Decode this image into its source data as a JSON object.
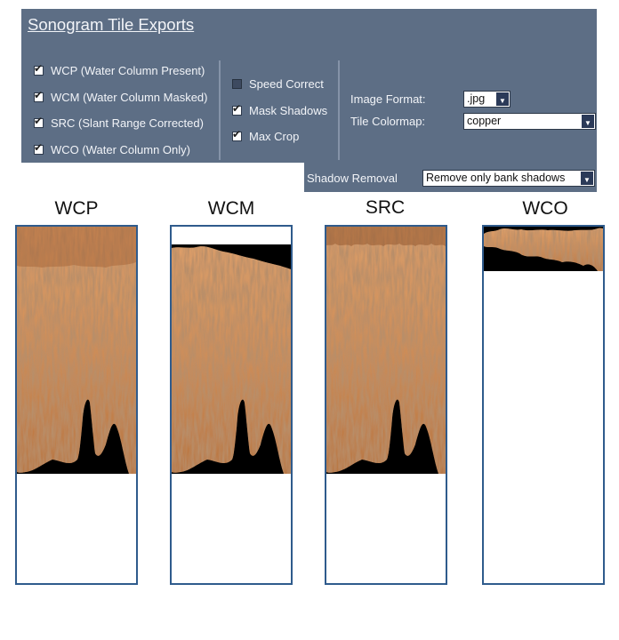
{
  "panel": {
    "title": "Sonogram Tile Exports",
    "exports": [
      {
        "label": "WCP (Water Column Present)",
        "checked": true
      },
      {
        "label": "WCM (Water Column Masked)",
        "checked": true
      },
      {
        "label": "SRC (Slant Range Corrected)",
        "checked": true
      },
      {
        "label": "WCO (Water Column Only)",
        "checked": true
      }
    ],
    "options": [
      {
        "label": "Speed Correct",
        "checked": false
      },
      {
        "label": "Mask Shadows",
        "checked": true
      },
      {
        "label": "Max Crop",
        "checked": true
      }
    ],
    "image_format": {
      "label": "Image Format:",
      "value": ".jpg"
    },
    "tile_colormap": {
      "label": "Tile Colormap:",
      "value": "copper"
    },
    "shadow_removal": {
      "label": "Shadow Removal",
      "value": "Remove only bank shadows"
    },
    "colors": {
      "panel_bg": "#5d6e85",
      "tile_border": "#2f5b8c",
      "copper": "#c98a55"
    }
  },
  "tiles": [
    {
      "label": "WCP"
    },
    {
      "label": "WCM"
    },
    {
      "label": "SRC"
    },
    {
      "label": "WCO"
    }
  ]
}
